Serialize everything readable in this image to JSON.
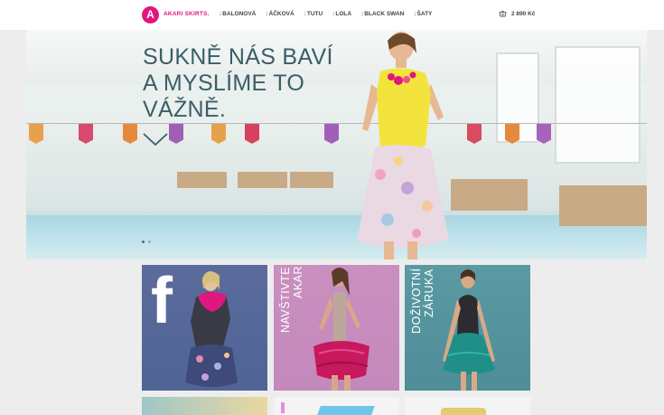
{
  "header": {
    "logo_letter": "A",
    "brand": "AKARI SKIRTS.",
    "nav": [
      {
        "label": "BALONOVÁ"
      },
      {
        "label": "ÁČKOVÁ"
      },
      {
        "label": "TUTU"
      },
      {
        "label": "LOLA"
      },
      {
        "label": "BLACK SWAN"
      },
      {
        "label": "ŠATY"
      }
    ],
    "nav_separator": ":",
    "cart": {
      "icon": "basket-icon",
      "price": "2 890 Kč"
    }
  },
  "hero": {
    "title_lines": [
      "SUKNĚ NÁS BAVÍ",
      "A MYSLÍME TO",
      "VÁŽNĚ."
    ],
    "slider_dots": 2,
    "active_dot": 1
  },
  "tiles": [
    {
      "name": "facebook",
      "icon": "facebook-f-icon",
      "letter": "f",
      "color": "#4f6395"
    },
    {
      "name": "visit",
      "lines": [
        "NAVŠTIVTE",
        "AKARI"
      ],
      "color": "#c98fbf"
    },
    {
      "name": "warranty",
      "lines": [
        "DOŽIVOTNÍ",
        "ZÁRUKA"
      ],
      "color": "#5a9aa3"
    }
  ],
  "colors": {
    "accent": "#e0177e",
    "title": "#3b5e67"
  }
}
